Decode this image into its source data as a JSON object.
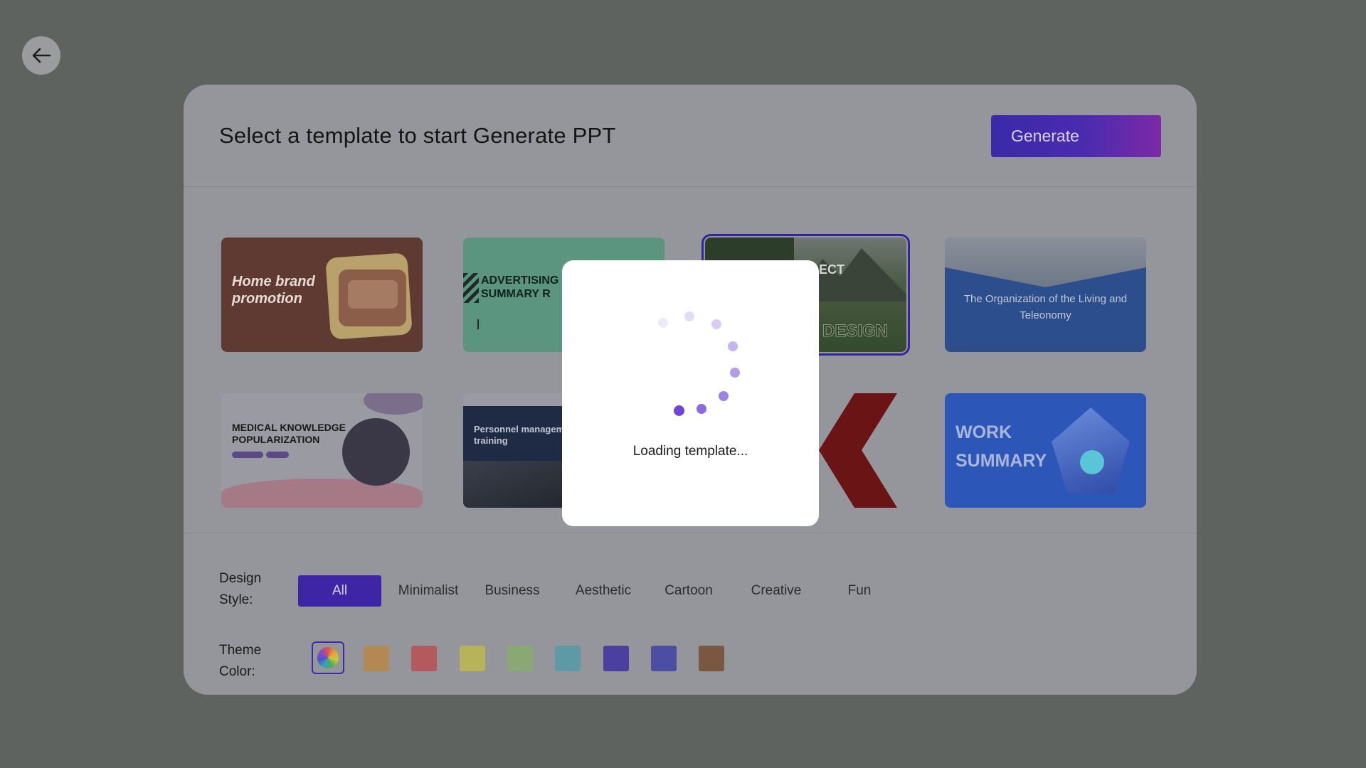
{
  "back_button": {
    "icon": "arrow-left-icon"
  },
  "header": {
    "title": "Select a template to start Generate PPT",
    "generate_label": "Generate"
  },
  "templates": [
    {
      "title": "Home brand promotion"
    },
    {
      "title": "ADVERTISING SUMMARY R"
    },
    {
      "title": "ECT",
      "subtitle": "DESIGN",
      "selected": true
    },
    {
      "title": "The Organization of the Living and Teleonomy"
    },
    {
      "title": "MEDICAL KNOWLEDGE POPULARIZATION"
    },
    {
      "title": "Personnel manageme training"
    },
    {
      "title": ""
    },
    {
      "title": "WORK SUMMARY"
    }
  ],
  "filters": {
    "design_style_label": "Design Style:",
    "styles": [
      "All",
      "Minimalist",
      "Business",
      "Aesthetic",
      "Cartoon",
      "Creative",
      "Fun"
    ],
    "selected_style": "All",
    "theme_color_label": "Theme Color:",
    "colors": [
      "#b38852",
      "#b45a5f",
      "#b7b35a",
      "#8aa874",
      "#5e9aa6",
      "#4b3fa0",
      "#4c4da3",
      "#7a5742"
    ]
  },
  "modal": {
    "loading_text": "Loading template...",
    "spinner_color": "#7c5ce0"
  }
}
